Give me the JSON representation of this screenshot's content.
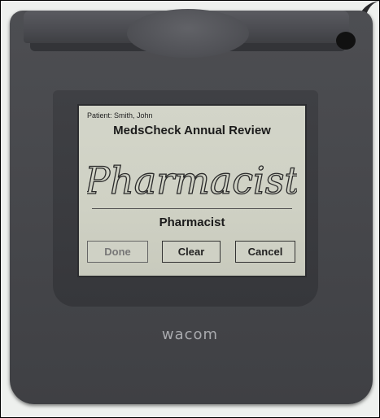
{
  "screen": {
    "patient_line": "Patient: Smith, John",
    "form_title": "MedsCheck Annual Review",
    "signature_text": "Pharmacist",
    "signer_label": "Pharmacist",
    "buttons": {
      "done": "Done",
      "clear": "Clear",
      "cancel": "Cancel"
    }
  },
  "device": {
    "brand": "wacom"
  }
}
